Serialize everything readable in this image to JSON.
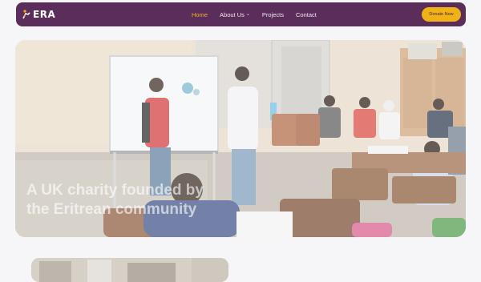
{
  "nav": {
    "logo_text": "ERA",
    "items": [
      {
        "label": "Home",
        "active": true
      },
      {
        "label": "About Us",
        "has_dropdown": true
      },
      {
        "label": "Projects"
      },
      {
        "label": "Contact"
      }
    ],
    "donate_label": "Donate Now"
  },
  "hero": {
    "heading_line1": "A UK charity founded by",
    "heading_line2": "the Eritrean community"
  },
  "colors": {
    "nav_bg": "#5b2d5a",
    "accent": "#f0b217",
    "page_bg": "#f6f5f7"
  }
}
